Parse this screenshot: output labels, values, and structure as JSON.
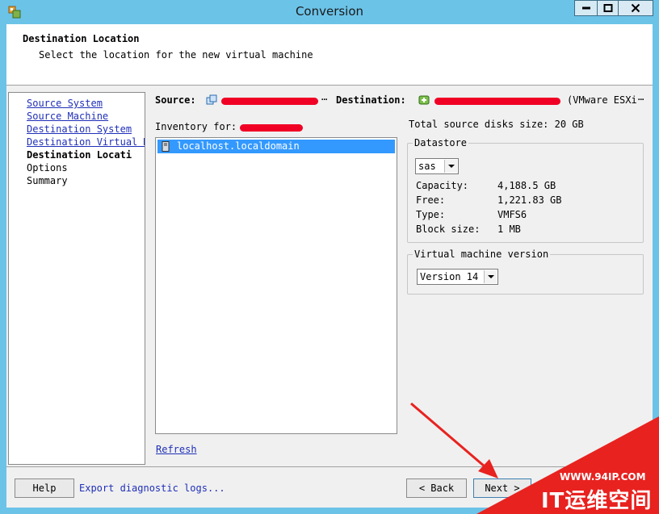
{
  "window": {
    "title": "Conversion"
  },
  "header": {
    "title": "Destination Location",
    "subtitle": "Select the location for the new virtual machine"
  },
  "steps": [
    {
      "label": "Source System",
      "state": "link"
    },
    {
      "label": "Source Machine",
      "state": "link"
    },
    {
      "label": "Destination System",
      "state": "link"
    },
    {
      "label": "Destination Virtual M",
      "state": "link"
    },
    {
      "label": "Destination Locati",
      "state": "current"
    },
    {
      "label": "Options",
      "state": "pending"
    },
    {
      "label": "Summary",
      "state": "pending"
    }
  ],
  "summary_bar": {
    "source_label": "Source:",
    "destination_label": "Destination:",
    "destination_suffix": "(VMware ESXi",
    "ellipsis": "⋯"
  },
  "inventory": {
    "label": "Inventory for:",
    "items": [
      "localhost.localdomain"
    ],
    "refresh_label": "Refresh"
  },
  "disks": {
    "total_text": "Total source disks size:  20 GB"
  },
  "datastore": {
    "group_label": "Datastore",
    "selected": "sas",
    "fields": [
      {
        "label": "Capacity:",
        "value": "4,188.5 GB"
      },
      {
        "label": "Free:",
        "value": "1,221.83 GB"
      },
      {
        "label": "Type:",
        "value": "VMFS6"
      },
      {
        "label": "Block size:",
        "value": "1 MB"
      }
    ]
  },
  "vm_version": {
    "group_label": "Virtual machine version",
    "selected": "Version 14"
  },
  "footer": {
    "help_label": "Help",
    "export_label": "Export diagnostic logs...",
    "back_label": "< Back",
    "next_label": "Next >"
  },
  "watermark": {
    "url": "WWW.94IP.COM",
    "brand": "IT运维空间"
  },
  "colors": {
    "accent": "#3399ff",
    "link": "#1f2fb8",
    "annotation": "#e8221f",
    "titlebar": "#6cc3e8"
  }
}
